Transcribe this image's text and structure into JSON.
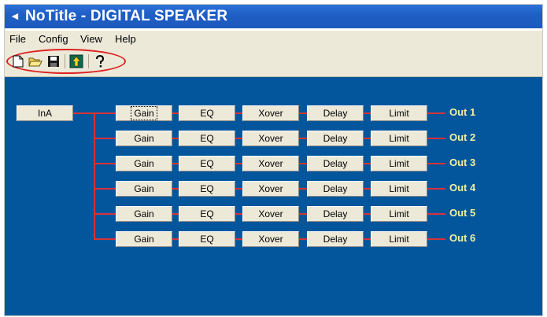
{
  "window": {
    "title": "NoTitle - DIGITAL SPEAKER",
    "title_icon": "speaker-icon"
  },
  "menu": [
    "File",
    "Config",
    "View",
    "Help"
  ],
  "toolbar": {
    "buttons": [
      {
        "name": "new-icon",
        "tooltip": ""
      },
      {
        "name": "open-folder-icon",
        "tooltip": ""
      },
      {
        "name": "save-icon",
        "tooltip": ""
      },
      {
        "name": "upload-icon",
        "tooltip": ""
      },
      {
        "name": "help-icon",
        "tooltip": ""
      }
    ],
    "highlight_color": "#e02020"
  },
  "colors": {
    "canvas": "#04569c",
    "wire": "#d8313a",
    "output_label": "#f2f0a0",
    "block": "#ece9d8"
  },
  "input": {
    "label": "InA"
  },
  "channels": [
    {
      "blocks": [
        "Gain",
        "EQ",
        "Xover",
        "Delay",
        "Limit"
      ],
      "output": "Out 1"
    },
    {
      "blocks": [
        "Gain",
        "EQ",
        "Xover",
        "Delay",
        "Limit"
      ],
      "output": "Out 2"
    },
    {
      "blocks": [
        "Gain",
        "EQ",
        "Xover",
        "Delay",
        "Limit"
      ],
      "output": "Out 3"
    },
    {
      "blocks": [
        "Gain",
        "EQ",
        "Xover",
        "Delay",
        "Limit"
      ],
      "output": "Out 4"
    },
    {
      "blocks": [
        "Gain",
        "EQ",
        "Xover",
        "Delay",
        "Limit"
      ],
      "output": "Out 5"
    },
    {
      "blocks": [
        "Gain",
        "EQ",
        "Xover",
        "Delay",
        "Limit"
      ],
      "output": "Out 6"
    }
  ]
}
